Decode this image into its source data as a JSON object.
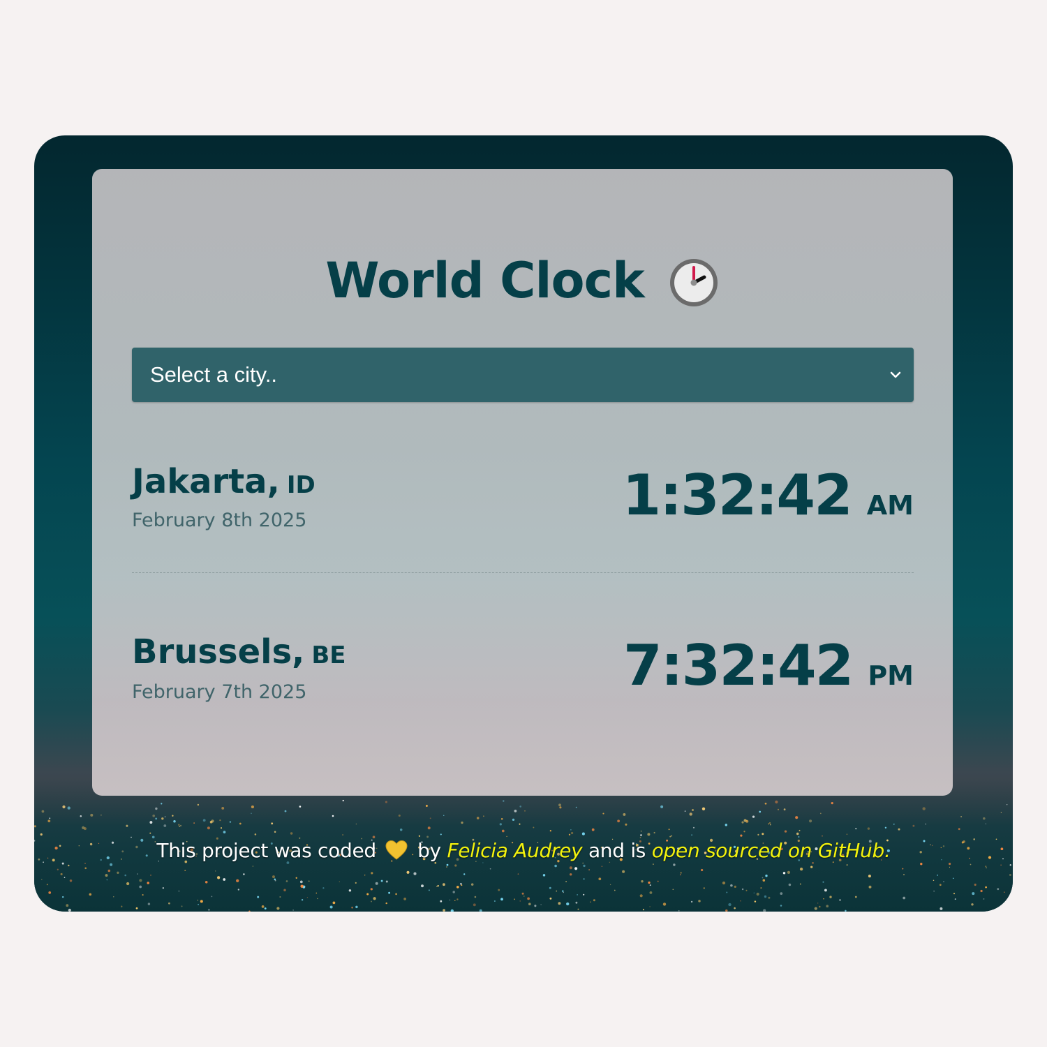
{
  "header": {
    "title": "World Clock",
    "title_icon": "clock-icon"
  },
  "city_select": {
    "selected_label": "Select a city..",
    "icon": "chevron-down-icon"
  },
  "cities": [
    {
      "name": "Jakarta,",
      "country": "ID",
      "date": "February 8th 2025",
      "time": "1:32:42",
      "period": "AM"
    },
    {
      "name": "Brussels,",
      "country": "BE",
      "date": "February 7th 2025",
      "time": "7:32:42",
      "period": "PM"
    }
  ],
  "footer": {
    "text_before": "This project was coded",
    "heart_icon": "yellow-heart-icon",
    "text_by": "by",
    "author_link": "Felicia Audrey",
    "text_and": "and is",
    "repo_link": "open sourced on GitHub."
  },
  "colors": {
    "page_background": "#f6f2f2",
    "accent_dark_teal": "#053f48",
    "select_background": "#30636a",
    "link_yellow": "#f3f20d",
    "date_text": "#40646a"
  }
}
